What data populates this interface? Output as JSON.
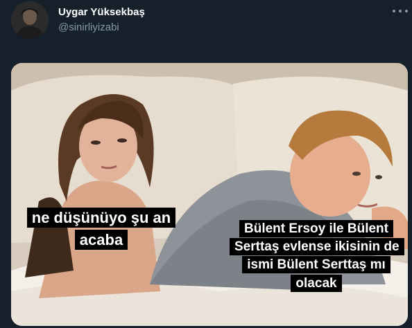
{
  "tweet": {
    "author": {
      "display_name": "Uygar Yüksekbaş",
      "handle": "@sinirliyizabi",
      "avatar_icon": "user-avatar"
    },
    "menu_icon": "more-options-icon"
  },
  "meme": {
    "caption_left": "ne düşünüyo şu an acaba",
    "caption_right": "Bülent Ersoy ile Bülent Serttaş evlense ikisinin de ismi Bülent Serttaş mı olacak",
    "caption_bg": "#000000",
    "caption_color": "#ffffff"
  },
  "colors": {
    "background": "#15202b",
    "name": "#ffffff",
    "handle": "#8899a6"
  }
}
